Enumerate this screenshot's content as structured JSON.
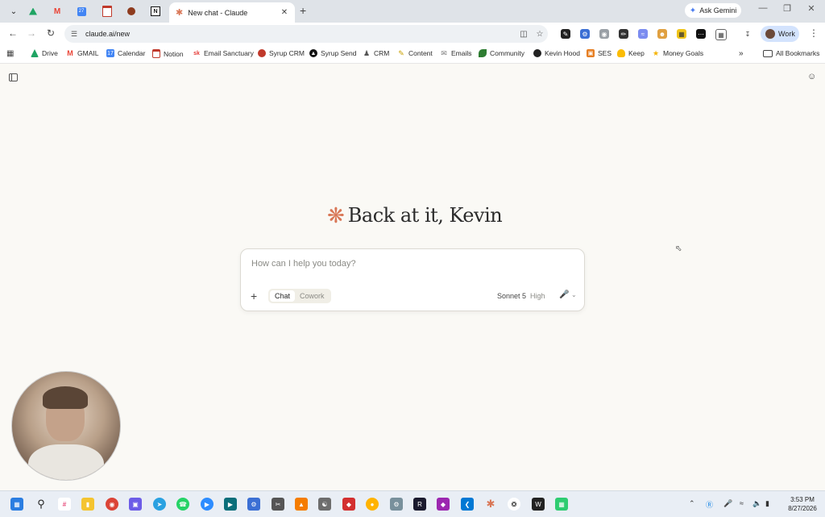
{
  "browser": {
    "tab_title": "New chat - Claude",
    "new_tab_glyph": "+",
    "ask_gemini": "Ask Gemini",
    "url": "claude.ai/new",
    "profile_label": "Work",
    "all_bookmarks": "All Bookmarks",
    "bookmarks_overflow": "»"
  },
  "bookmarks": [
    {
      "label": "Drive",
      "color": "#1fa463"
    },
    {
      "label": "GMAIL",
      "color": "#ea4335"
    },
    {
      "label": "Calendar",
      "color": "#4285f4"
    },
    {
      "label": "Notion",
      "color": "#ffffff"
    },
    {
      "label": "Email Sanctuary",
      "color": "#e53935"
    },
    {
      "label": "Syrup CRM",
      "color": "#c0392b"
    },
    {
      "label": "Syrup Send",
      "color": "#111111"
    },
    {
      "label": "CRM",
      "color": "#555555"
    },
    {
      "label": "Content",
      "color": "#f1c40f"
    },
    {
      "label": "Emails",
      "color": "#888888"
    },
    {
      "label": "Community",
      "color": "#2e7d32"
    },
    {
      "label": "Kevin Hood",
      "color": "#222222"
    },
    {
      "label": "SES",
      "color": "#e67e22"
    },
    {
      "label": "Keep",
      "color": "#fbbc04"
    },
    {
      "label": "Money Goals",
      "color": "#f5b301"
    }
  ],
  "page": {
    "greeting": "Back at it, Kevin",
    "placeholder": "How can I help you today?",
    "mode_chat": "Chat",
    "mode_cowork": "Cowork",
    "model": "Sonnet 5",
    "effort": "High",
    "accent": "#d97757"
  },
  "taskbar": {
    "time": "3:53 PM",
    "date": "8/27/2026"
  }
}
